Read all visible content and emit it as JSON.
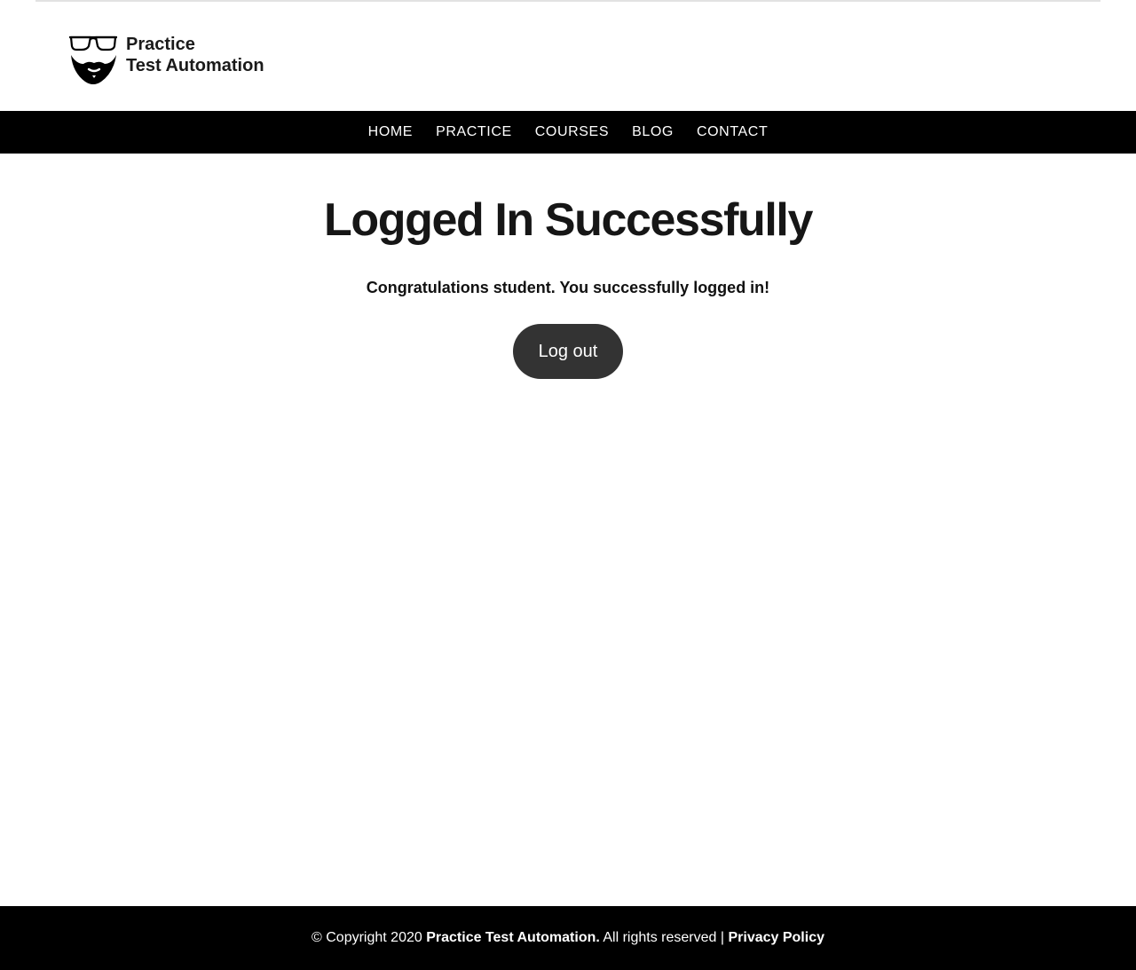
{
  "header": {
    "logo_line1": "Practice",
    "logo_line2": "Test Automation",
    "logo_icon": "glasses-beard-icon"
  },
  "nav": {
    "items": [
      {
        "label": "HOME"
      },
      {
        "label": "PRACTICE"
      },
      {
        "label": "COURSES"
      },
      {
        "label": "BLOG"
      },
      {
        "label": "CONTACT"
      }
    ]
  },
  "main": {
    "title": "Logged In Successfully",
    "message": "Congratulations student. You successfully logged in!",
    "logout_label": "Log out"
  },
  "footer": {
    "copyright": "© Copyright 2020 ",
    "company": "Practice Test Automation.",
    "rights": " All rights reserved | ",
    "privacy": "Privacy Policy"
  },
  "colors": {
    "nav_background": "#000000",
    "button_background": "#333333",
    "footer_background": "#000000",
    "text": "#111111"
  }
}
